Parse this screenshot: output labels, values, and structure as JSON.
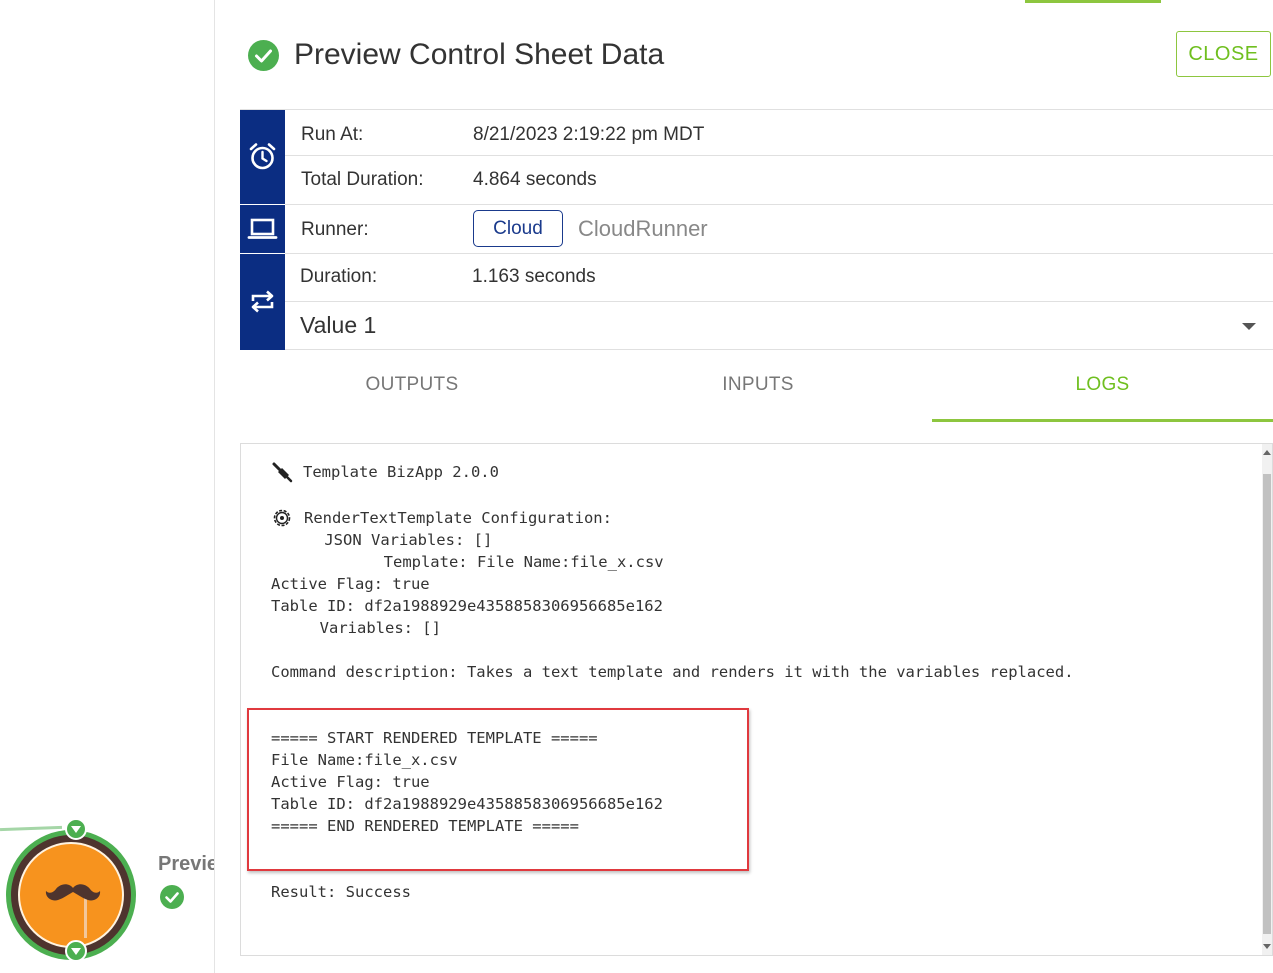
{
  "canvas": {
    "node_label": "Previe",
    "node_icon": "mustache-icon"
  },
  "header": {
    "title": "Preview Control Sheet Data",
    "status_icon": "check-circle-icon",
    "close_label": "CLOSE"
  },
  "run_info": {
    "run_at_label": "Run At:",
    "run_at_value": "8/21/2023 2:19:22 pm MDT",
    "total_duration_label": "Total Duration:",
    "total_duration_value": "4.864 seconds",
    "runner_label": "Runner:",
    "runner_badge": "Cloud",
    "runner_name": "CloudRunner",
    "duration_label": "Duration:",
    "duration_value": "1.163 seconds",
    "iteration_select": "Value 1"
  },
  "tabs": [
    {
      "label": "OUTPUTS"
    },
    {
      "label": "INPUTS"
    },
    {
      "label": "LOGS"
    }
  ],
  "logs": {
    "lines": [
      "Template BizApp 2.0.0",
      "RenderTextTemplate Configuration:",
      "    JSON Variables: []",
      "           Template: File Name:file_x.csv",
      "Active Flag: true",
      "Table ID: df2a1988929e4358858306956685e162",
      "     Variables: []",
      "Command description: Takes a text template and renders it with the variables replaced.",
      "===== START RENDERED TEMPLATE =====",
      "File Name:file_x.csv",
      "Active Flag: true",
      "Table ID: df2a1988929e4358858306956685e162",
      "===== END RENDERED TEMPLATE =====",
      "Result: Success"
    ]
  },
  "colors": {
    "accent_green": "#8dc63f",
    "navy": "#0b2d82",
    "success": "#4caf50",
    "highlight_red": "#e0393e",
    "node_orange": "#f7931e"
  }
}
